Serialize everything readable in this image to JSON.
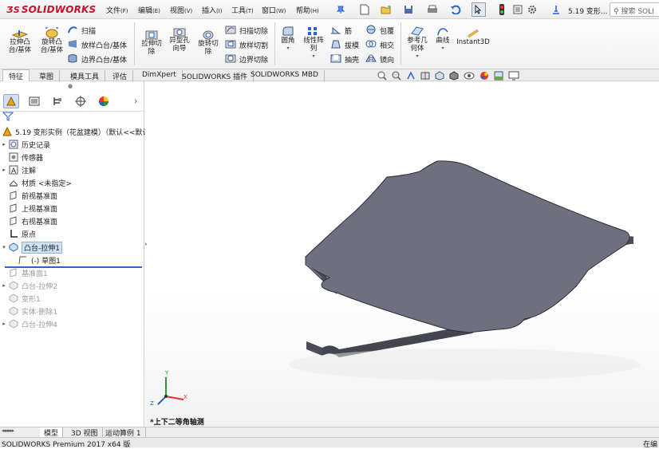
{
  "app": {
    "brand": "SOLIDWORKS",
    "doc_title": "5.19 变形...",
    "search_placeholder": "搜索 SOLI"
  },
  "menu": [
    {
      "label": "文件",
      "key": "(F)"
    },
    {
      "label": "编辑",
      "key": "(E)"
    },
    {
      "label": "视图",
      "key": "(V)"
    },
    {
      "label": "插入",
      "key": "(I)"
    },
    {
      "label": "工具",
      "key": "(T)"
    },
    {
      "label": "窗口",
      "key": "(W)"
    },
    {
      "label": "帮助",
      "key": "(H)"
    }
  ],
  "ribbon": {
    "extrude_boss": "拉伸凸台/基体",
    "revolve_boss": "旋转凸台/基体",
    "sweep": "扫描",
    "loft_boss": "放样凸台/基体",
    "boundary_boss": "边界凸台/基体",
    "extrude_cut": "拉伸切除",
    "hole_wizard": "异型孔向导",
    "revolve_cut": "旋转切除",
    "sweep_cut": "扫描切除",
    "loft_cut": "放样切割",
    "boundary_cut": "边界切除",
    "fillet": "圆角",
    "linear_pattern": "线性阵列",
    "rib": "筋",
    "draft": "拔模",
    "shell": "抽壳",
    "wrap": "包覆",
    "intersect": "相交",
    "mirror": "镜向",
    "ref_geometry": "参考几何体",
    "curves": "曲线",
    "instant3d": "Instant3D"
  },
  "tabs": [
    "特征",
    "草图",
    "模具工具",
    "评估",
    "DimXpert",
    "SOLIDWORKS 插件",
    "SOLIDWORKS MBD"
  ],
  "tree": {
    "root": "5.19 变形实例（花盆建模）（默认<<默认",
    "items": [
      {
        "label": "历史记录"
      },
      {
        "label": "传感器"
      },
      {
        "label": "注解"
      },
      {
        "label": "材质 <未指定>"
      },
      {
        "label": "前视基准面"
      },
      {
        "label": "上视基准面"
      },
      {
        "label": "右视基准面"
      },
      {
        "label": "原点"
      },
      {
        "label": "凸台-拉伸1"
      },
      {
        "label": "(-) 草图1"
      },
      {
        "label": "基准面1"
      },
      {
        "label": "凸台-拉伸2"
      },
      {
        "label": "变形1"
      },
      {
        "label": "实体-删除1"
      },
      {
        "label": "凸台-拉伸4"
      }
    ]
  },
  "viewport": {
    "view_label": "*上下二等角轴测",
    "axis_y": "Y",
    "axis_x": "X",
    "axis_z": "Z"
  },
  "bottom_tabs": [
    "模型",
    "3D 视图",
    "运动算例 1"
  ],
  "status": {
    "left": "SOLIDWORKS Premium 2017 x64 版",
    "right": "在编"
  },
  "colors": {
    "brand": "#c8102e",
    "accent": "#2a63c9",
    "model_top": "#6e7080",
    "model_side": "#4a4c58"
  }
}
